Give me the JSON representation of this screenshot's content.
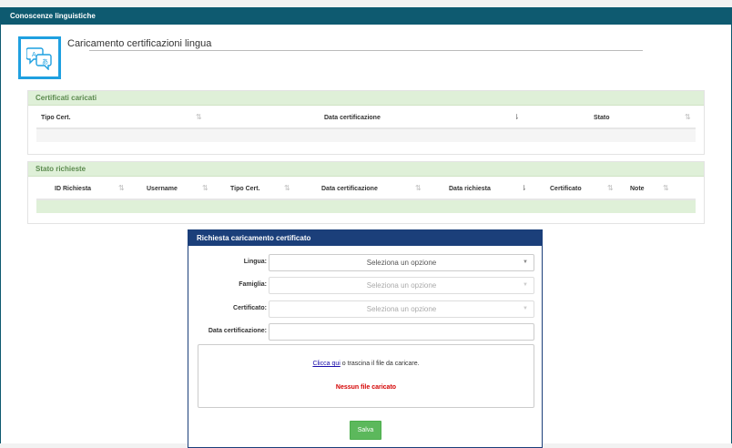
{
  "topbar": {
    "title": "Conoscenze linguistiche"
  },
  "page": {
    "title": "Caricamento certificazioni lingua",
    "icon": "language-chat-icon"
  },
  "certificati": {
    "title": "Certificati caricati",
    "columns": [
      "Tipo Cert.",
      "Data certificazione",
      "Stato"
    ]
  },
  "stato_richieste": {
    "title": "Stato richieste",
    "columns": [
      "ID Richiesta",
      "Username",
      "Tipo Cert.",
      "Data certificazione",
      "Data richiesta",
      "Certificato",
      "Note"
    ]
  },
  "form": {
    "title": "Richiesta caricamento certificato",
    "lingua_label": "Lingua:",
    "lingua_value": "Seleziona un opzione",
    "famiglia_label": "Famiglia:",
    "famiglia_value": "Seleziona un opzione",
    "certificato_label": "Certificato:",
    "certificato_value": "Seleziona un opzione",
    "data_label": "Data certificazione:",
    "data_value": "",
    "upload_link": "Clicca qui",
    "upload_text": " o trascina il file da caricare.",
    "no_file": "Nessun file caricato",
    "save_label": "Salva"
  },
  "colors": {
    "topbar": "#0e5a70",
    "form_header": "#1b3f7a",
    "panel_header": "#dff0d8",
    "save": "#5cb85c",
    "icon_border": "#1fa0e0"
  }
}
